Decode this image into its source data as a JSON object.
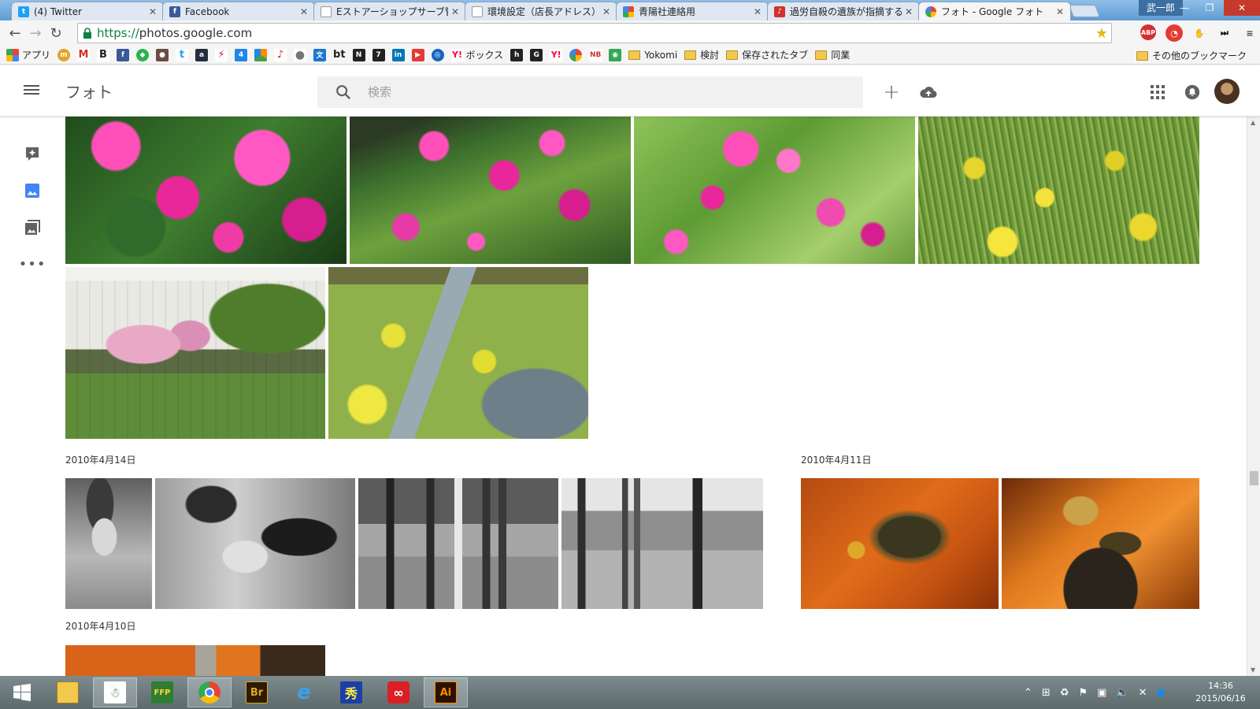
{
  "browser": {
    "tabs": [
      {
        "label": "(4) Twitter",
        "icon": "twitter-icon",
        "color": "#1da1f2"
      },
      {
        "label": "Facebook",
        "icon": "facebook-icon",
        "color": "#3b5998"
      },
      {
        "label": "Eストアーショップサーブ管理",
        "icon": "page-icon",
        "color": "#9e9e9e"
      },
      {
        "label": "環境設定（店長アドレス）",
        "icon": "page-icon",
        "color": "#9e9e9e"
      },
      {
        "label": "青陽社連絡用",
        "icon": "multicolor-icon",
        "color": "#f4b400"
      },
      {
        "label": "過労自殺の遺族が指摘する",
        "icon": "pdf-icon",
        "color": "#d32f2f"
      },
      {
        "label": "フォト - Google フォト",
        "icon": "google-photos-icon",
        "color": "#4285f4"
      }
    ],
    "window_user": "武一郎",
    "url_scheme": "https://",
    "url_host": "photos.google.com",
    "bookmarks": [
      {
        "label": "アプリ",
        "icon": "apps-grid-icon",
        "color": "#e53935"
      },
      {
        "label": "",
        "icon": "m-coin-icon",
        "color": "#e0a526"
      },
      {
        "label": "",
        "icon": "gmail-icon",
        "color": "#d93025"
      },
      {
        "label": "",
        "icon": "b-icon",
        "color": "#222222"
      },
      {
        "label": "",
        "icon": "facebook-icon",
        "color": "#3b5998"
      },
      {
        "label": "",
        "icon": "feedly-icon",
        "color": "#2bb24c"
      },
      {
        "label": "",
        "icon": "person-icon",
        "color": "#6d4c41"
      },
      {
        "label": "",
        "icon": "twitter-icon",
        "color": "#1da1f2"
      },
      {
        "label": "",
        "icon": "amazon-icon",
        "color": "#232f3e"
      },
      {
        "label": "",
        "icon": "lightning-icon",
        "color": "#c2185b"
      },
      {
        "label": "",
        "icon": "calendar-icon",
        "color": "#1e88e5"
      },
      {
        "label": "",
        "icon": "pinwheel-icon",
        "color": "#fb8c00"
      },
      {
        "label": "",
        "icon": "pdf-icon",
        "color": "#c62828"
      },
      {
        "label": "",
        "icon": "apple-icon",
        "color": "#757575"
      },
      {
        "label": "",
        "icon": "translate-icon",
        "color": "#1976d2"
      },
      {
        "label": "bt",
        "icon": "",
        "color": "#222222"
      },
      {
        "label": "",
        "icon": "n-icon",
        "color": "#222222"
      },
      {
        "label": "",
        "icon": "seven-icon",
        "color": "#222222"
      },
      {
        "label": "",
        "icon": "linkedin-icon",
        "color": "#0077b5"
      },
      {
        "label": "",
        "icon": "youtube-icon",
        "color": "#e53935"
      },
      {
        "label": "",
        "icon": "globe-icon",
        "color": "#1565c0"
      },
      {
        "label": "ボックス",
        "icon": "yahoo-icon",
        "color": "#ff0033"
      },
      {
        "label": "",
        "icon": "h-icon",
        "color": "#222222"
      },
      {
        "label": "",
        "icon": "g-icon",
        "color": "#222222"
      },
      {
        "label": "",
        "icon": "yahoo-icon",
        "color": "#ff0033"
      },
      {
        "label": "",
        "icon": "photos-pinwheel-icon",
        "color": "#fbbc05"
      },
      {
        "label": "",
        "icon": "nb-icon",
        "color": "#d32f2f"
      },
      {
        "label": "",
        "icon": "maps-icon",
        "color": "#34a853"
      },
      {
        "label": "Yokomi",
        "icon": "folder-icon",
        "color": "#f2c94c"
      },
      {
        "label": "検討",
        "icon": "folder-icon",
        "color": "#f2c94c"
      },
      {
        "label": "保存されたタブ",
        "icon": "folder-icon",
        "color": "#f2c94c"
      },
      {
        "label": "同業",
        "icon": "folder-icon",
        "color": "#f2c94c"
      }
    ],
    "other_bookmarks": "その他のブックマーク"
  },
  "app": {
    "title": "フォト",
    "search_placeholder": "検索",
    "accent": "#4285f4"
  },
  "photos": {
    "groups": [
      {
        "date": "",
        "photos": [
          {
            "alt": "pink-azalea-closeup",
            "desc": ""
          },
          {
            "alt": "pink-azalea-bush",
            "desc": ""
          },
          {
            "alt": "pink-azalea-bush-2",
            "desc": ""
          },
          {
            "alt": "yellow-rapeseed-field",
            "desc": ""
          },
          {
            "alt": "cherry-blossom-apartments",
            "desc": ""
          },
          {
            "alt": "stream-with-rapeseed",
            "desc": ""
          }
        ]
      },
      {
        "date": "2010年4月14日",
        "photos": [
          {
            "alt": "bw-child-portrait",
            "desc": ""
          },
          {
            "alt": "bw-family-indoors",
            "desc": ""
          },
          {
            "alt": "bw-family-group-outdoors",
            "desc": ""
          },
          {
            "alt": "bw-family-walking-street",
            "desc": ""
          }
        ]
      },
      {
        "date": "2010年4月11日",
        "photos": [
          {
            "alt": "turtle-on-orange-brick",
            "desc": ""
          },
          {
            "alt": "turtle-on-rock",
            "desc": ""
          }
        ]
      },
      {
        "date": "2010年4月10日",
        "photos": [
          {
            "alt": "orange-partial-photo",
            "desc": ""
          }
        ]
      }
    ]
  },
  "taskbar": {
    "apps": [
      {
        "name": "start-button",
        "icon": "windows-logo-icon"
      },
      {
        "name": "file-explorer",
        "icon": "folder-icon"
      },
      {
        "name": "app-penguin",
        "icon": "penguin-icon"
      },
      {
        "name": "ffftp",
        "icon": "ffftp-icon"
      },
      {
        "name": "chrome",
        "icon": "chrome-icon"
      },
      {
        "name": "bridge",
        "icon": "bridge-icon",
        "label": "Br"
      },
      {
        "name": "internet-explorer",
        "icon": "ie-icon"
      },
      {
        "name": "font-tool",
        "icon": "kanji-icon",
        "label": "秀"
      },
      {
        "name": "creative-cloud",
        "icon": "creative-cloud-icon"
      },
      {
        "name": "illustrator",
        "icon": "illustrator-icon",
        "label": "Ai"
      }
    ],
    "time": "14:36",
    "date": "2015/06/16"
  }
}
